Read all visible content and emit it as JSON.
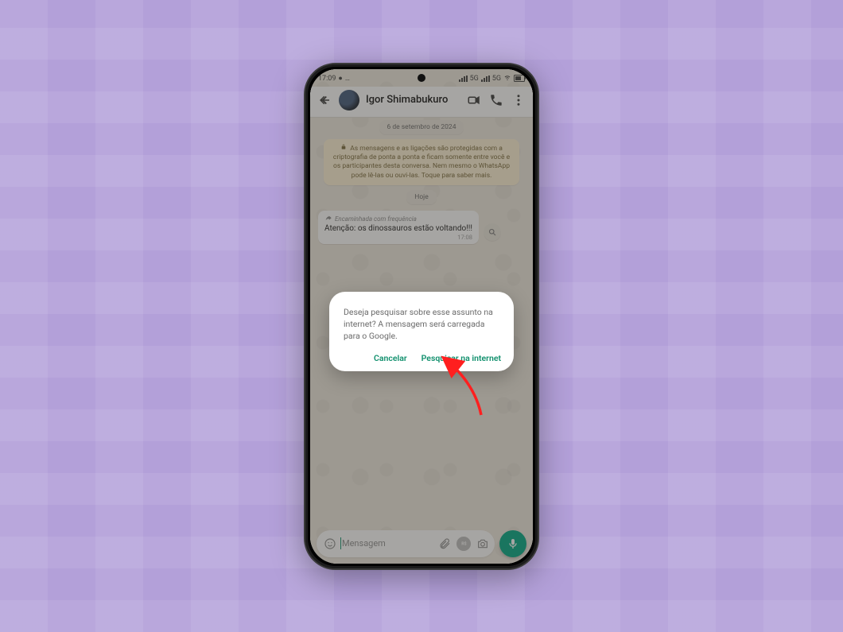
{
  "statusbar": {
    "time": "17:09",
    "network_label": "5G"
  },
  "header": {
    "contact_name": "Igor Shimabukuro"
  },
  "dates": {
    "first": "6 de setembro de 2024",
    "today": "Hoje"
  },
  "encryption_notice": "As mensagens e as ligações são protegidas com a criptografia de ponta a ponta e ficam somente entre você e os participantes desta conversa. Nem mesmo o WhatsApp pode lê-las ou ouvi-las. Toque para saber mais.",
  "message": {
    "forwarded_label": "Encaminhada com frequência",
    "text": "Atenção: os dinossauros estão voltando!!!",
    "time": "17:08"
  },
  "dialog": {
    "body": "Deseja pesquisar sobre esse assunto na internet? A mensagem será carregada para o Google.",
    "cancel": "Cancelar",
    "confirm": "Pesquisar na internet"
  },
  "composer": {
    "placeholder": "Mensagem"
  }
}
